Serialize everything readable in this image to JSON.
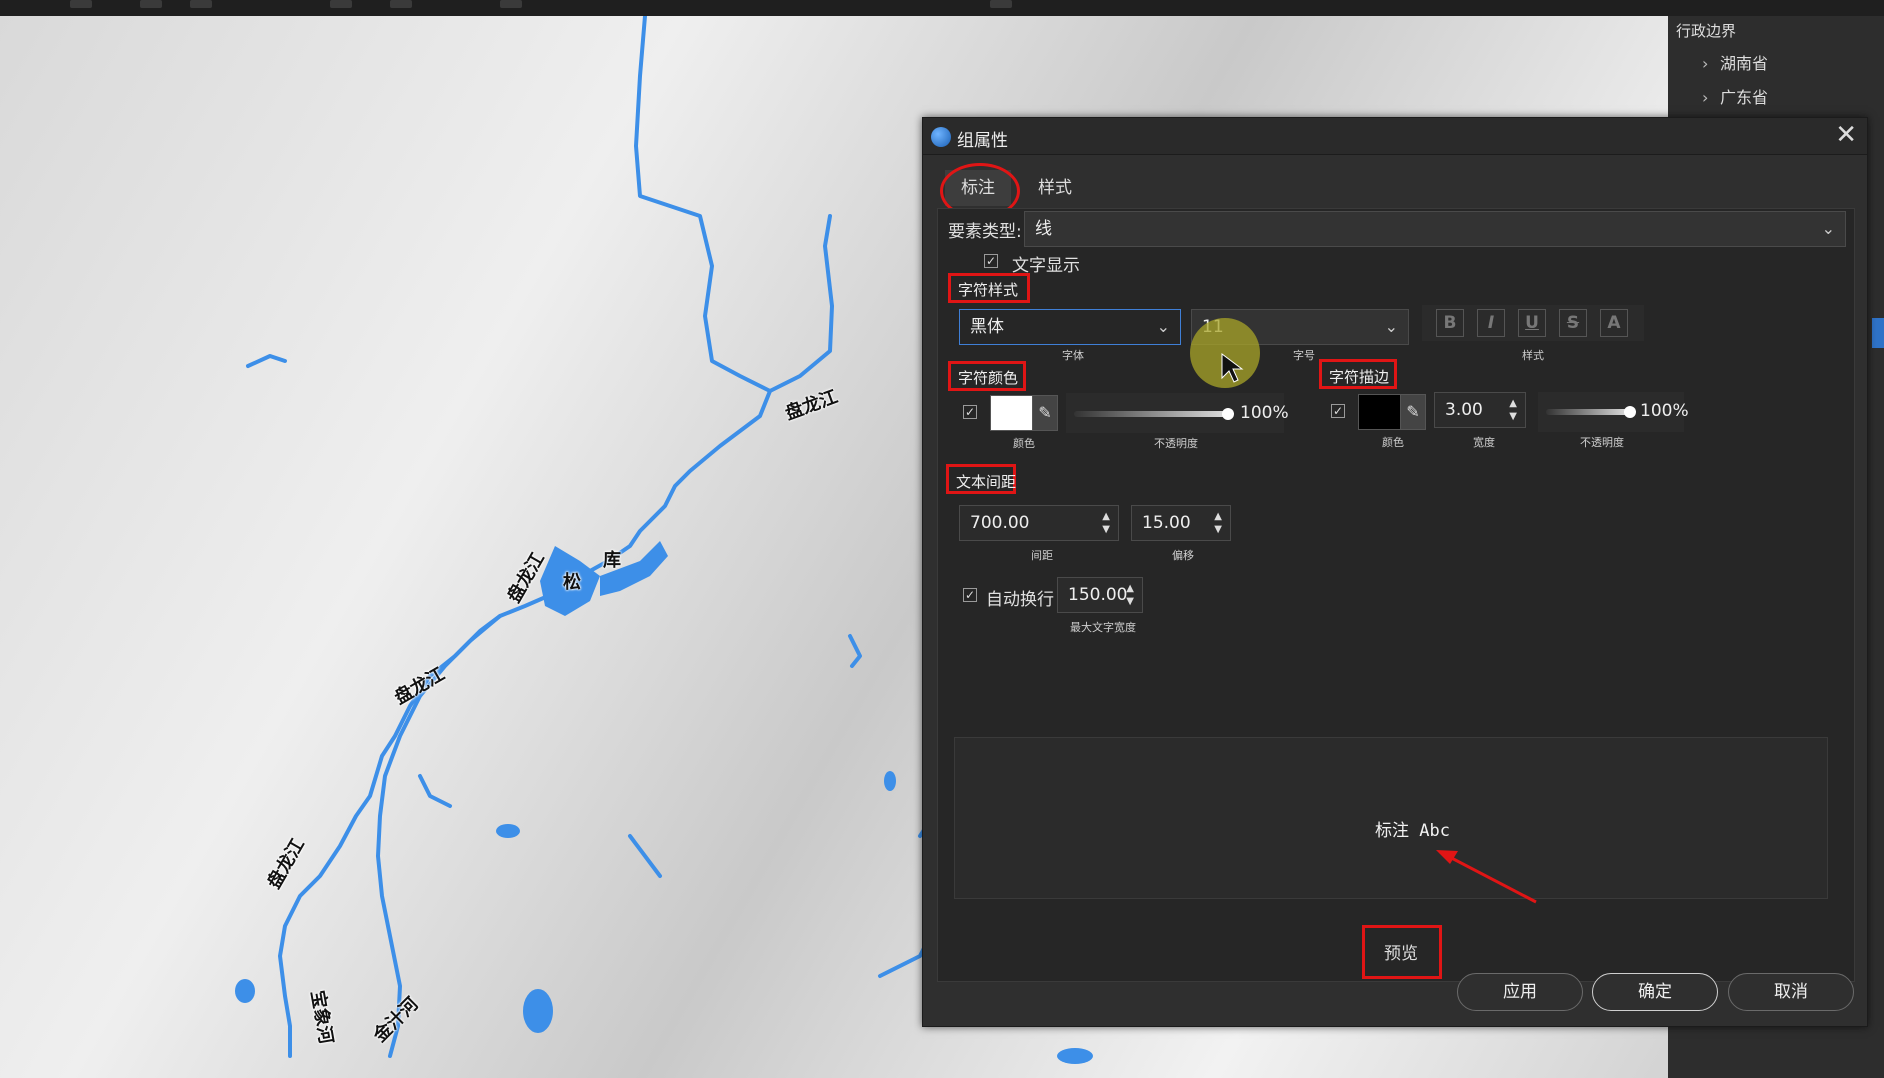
{
  "map": {
    "labels": [
      {
        "id": "l1",
        "text": "盘龙江"
      },
      {
        "id": "l2",
        "text": "盘龙江"
      },
      {
        "id": "l3",
        "text": "松"
      },
      {
        "id": "l4",
        "text": "库"
      },
      {
        "id": "l5",
        "text": "盘龙江"
      },
      {
        "id": "l6",
        "text": "盘龙江"
      },
      {
        "id": "l7",
        "text": "宝象河"
      },
      {
        "id": "l8",
        "text": "金汁河"
      }
    ],
    "water_color": "#3d8fe8"
  },
  "right_panel": {
    "title": "行政边界",
    "items": [
      {
        "label": "湖南省",
        "icon": "chevron-right-icon"
      },
      {
        "label": "广东省",
        "icon": "chevron-right-icon"
      }
    ]
  },
  "dialog": {
    "title": "组属性",
    "close_icon": "close-icon",
    "tabs": [
      {
        "label": "标注",
        "active": true
      },
      {
        "label": "样式",
        "active": false
      }
    ],
    "feature_type": {
      "label": "要素类型:",
      "value": "线"
    },
    "text_display": {
      "label": "文字显示",
      "checked": true
    },
    "char_style": {
      "section": "字符样式",
      "font": {
        "value": "黑体",
        "caption": "字体"
      },
      "size": {
        "value": "11",
        "caption": "字号"
      },
      "style_caption": "样式",
      "style_buttons": [
        "B",
        "I",
        "U",
        "S",
        "A"
      ]
    },
    "char_color": {
      "section": "字符颜色",
      "enabled": true,
      "color": "#ffffff",
      "color_caption": "颜色",
      "opacity": "100%",
      "opacity_caption": "不透明度"
    },
    "char_outline": {
      "section": "字符描边",
      "enabled": true,
      "color": "#000000",
      "color_caption": "颜色",
      "width": "3.00",
      "width_caption": "宽度",
      "opacity": "100%",
      "opacity_caption": "不透明度"
    },
    "text_spacing": {
      "section": "文本间距",
      "spacing": {
        "value": "700.00",
        "caption": "间距"
      },
      "offset": {
        "value": "15.00",
        "caption": "偏移"
      }
    },
    "auto_wrap": {
      "label": "自动换行",
      "checked": true,
      "max_width": "150.00",
      "caption": "最大文字宽度"
    },
    "preview_text": "标注 Abc",
    "preview_button": "预览",
    "buttons": {
      "apply": "应用",
      "ok": "确定",
      "cancel": "取消"
    }
  },
  "accent_red": "#e01515"
}
